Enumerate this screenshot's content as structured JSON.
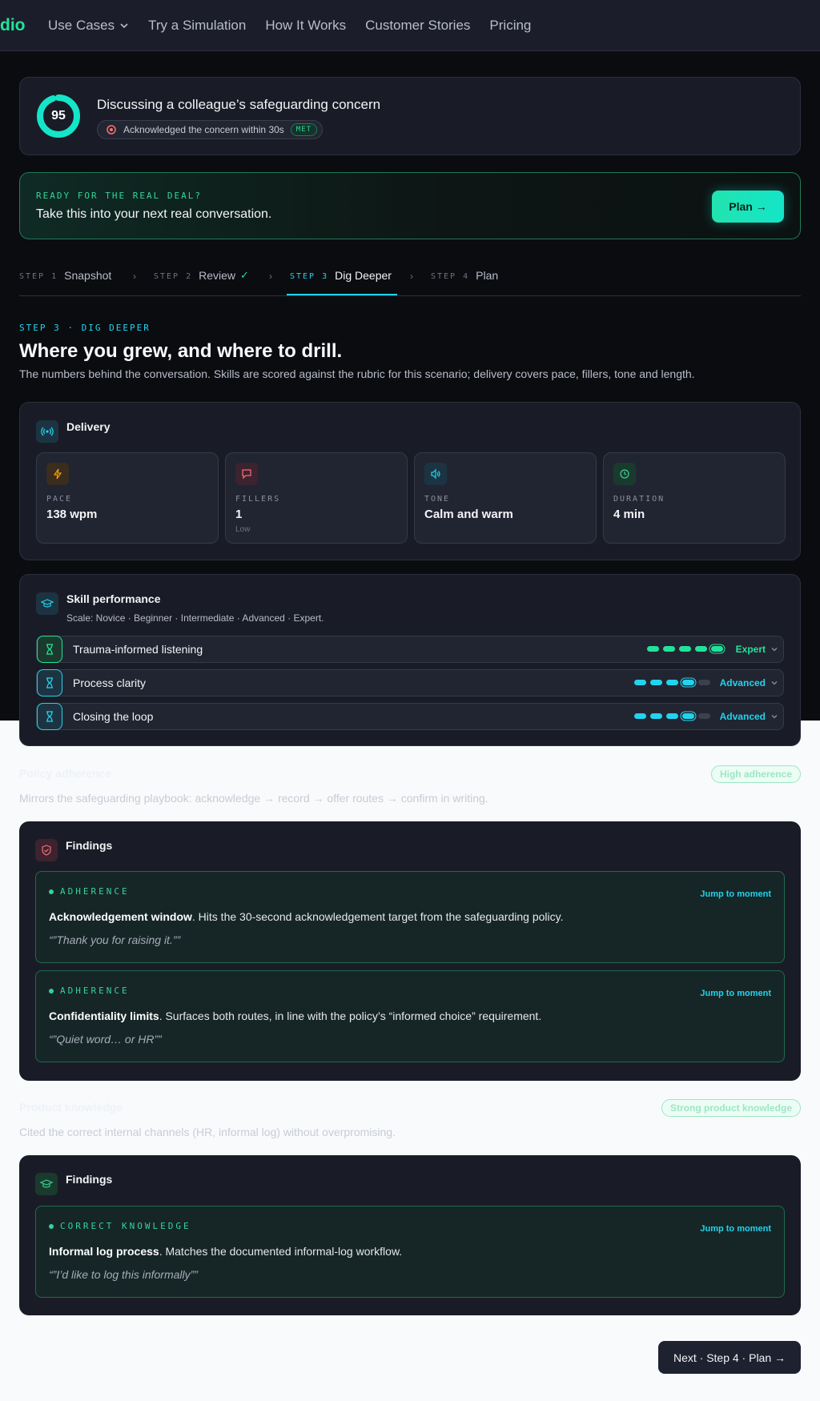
{
  "nav": {
    "brand": "dio",
    "links": [
      "Use Cases",
      "Try a Simulation",
      "How It Works",
      "Customer Stories",
      "Pricing"
    ]
  },
  "score": {
    "value": "95",
    "progress": 0.95,
    "title": "Discussing a colleague’s safeguarding concern",
    "chip_text": "Acknowledged the concern within 30s",
    "chip_badge": "MET"
  },
  "ready": {
    "kicker": "READY FOR THE REAL DEAL?",
    "text": "Take this into your next real conversation.",
    "button": "Plan →"
  },
  "steps": [
    {
      "num": "STEP 1",
      "label": "Snapshot"
    },
    {
      "num": "STEP 2",
      "label": "Review",
      "check": "✓"
    },
    {
      "num": "STEP 3",
      "label": "Dig Deeper"
    },
    {
      "num": "STEP 4",
      "label": "Plan"
    }
  ],
  "step_separator": "›",
  "section": {
    "kicker": "STEP 3 · DIG DEEPER",
    "title": "Where you grew, and where to drill.",
    "description": "The numbers behind the conversation. Skills are scored against the rubric for this scenario; delivery covers pace, fillers, tone and length."
  },
  "delivery": {
    "title": "Delivery",
    "metrics": [
      {
        "label": "PACE",
        "value": "138 wpm",
        "sub": ""
      },
      {
        "label": "FILLERS",
        "value": "1",
        "sub": "Low"
      },
      {
        "label": "TONE",
        "value": "Calm and warm",
        "sub": ""
      },
      {
        "label": "DURATION",
        "value": "4 min",
        "sub": ""
      }
    ]
  },
  "skills": {
    "title": "Skill performance",
    "scale": "Scale: Novice · Beginner · Intermediate · Advanced · Expert.",
    "rows": [
      {
        "name": "Trauma-informed listening",
        "level": "Expert",
        "filled": 5,
        "total": 5,
        "color": "#22e39a"
      },
      {
        "name": "Process clarity",
        "level": "Advanced",
        "filled": 4,
        "total": 5,
        "color": "#22d3ee"
      },
      {
        "name": "Closing the loop",
        "level": "Advanced",
        "filled": 4,
        "total": 5,
        "color": "#22d3ee"
      }
    ]
  },
  "policy": {
    "title": "Policy adherence",
    "pill": "High adherence",
    "description": "Mirrors the safeguarding playbook: acknowledge → record → offer routes → confirm in writing.",
    "findings_title": "Findings",
    "findings": [
      {
        "kicker": "ADHERENCE",
        "jump": "Jump to moment",
        "bold": "Acknowledgement window",
        "text": ". Hits the 30-second acknowledgement target from the safeguarding policy.",
        "quote": "“”Thank you for raising it.””"
      },
      {
        "kicker": "ADHERENCE",
        "jump": "Jump to moment",
        "bold": "Confidentiality limits",
        "text": ". Surfaces both routes, in line with the policy’s “informed choice” requirement.",
        "quote": "“”Quiet word… or HR””"
      }
    ]
  },
  "product": {
    "title": "Product knowledge",
    "pill": "Strong product knowledge",
    "description": "Cited the correct internal channels (HR, informal log) without overpromising.",
    "findings_title": "Findings",
    "findings": [
      {
        "kicker": "CORRECT KNOWLEDGE",
        "jump": "Jump to moment",
        "bold": "Informal log process",
        "text": ". Matches the documented informal-log workflow.",
        "quote": "“”I’d like to log this informally””"
      }
    ]
  },
  "next_button": "Next · Step 4 · Plan  →",
  "colors": {
    "accent_green": "#22e39a",
    "accent_cyan": "#22d3ee",
    "panel": "#191c26"
  }
}
